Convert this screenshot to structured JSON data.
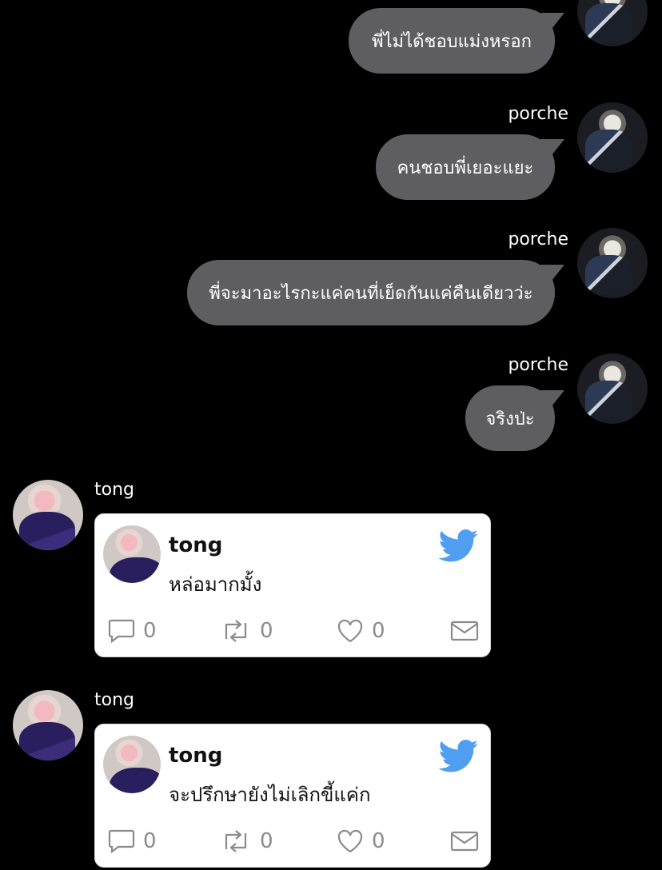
{
  "messages_out": [
    {
      "sender": "",
      "text": "พี่ไม่ได้ชอบแม่งหรอก"
    },
    {
      "sender": "porche",
      "text": "คนชอบพี่เยอะแยะ"
    },
    {
      "sender": "porche",
      "text": "พี่จะมาอะไรกะแค่คนที่เย็ดกันแค่คืนเดียวว่ะ"
    },
    {
      "sender": "porche",
      "text": "จริงป่ะ"
    }
  ],
  "tweets": [
    {
      "sender": "tong",
      "author": "tong",
      "text": "หล่อมากมั้ง",
      "replies": "0",
      "retweets": "0",
      "likes": "0"
    },
    {
      "sender": "tong",
      "author": "tong",
      "text": "จะปรึกษายังไม่เลิกขี้แค่ก",
      "replies": "0",
      "retweets": "0",
      "likes": "0"
    }
  ],
  "colors": {
    "bubble": "#5e5e60",
    "twitter_blue": "#4f9ef0",
    "action_gray": "#8a8a8a"
  },
  "icons": {
    "reply": "reply-icon",
    "retweet": "retweet-icon",
    "like": "heart-icon",
    "share": "mail-icon",
    "brand": "twitter-bird-icon"
  }
}
